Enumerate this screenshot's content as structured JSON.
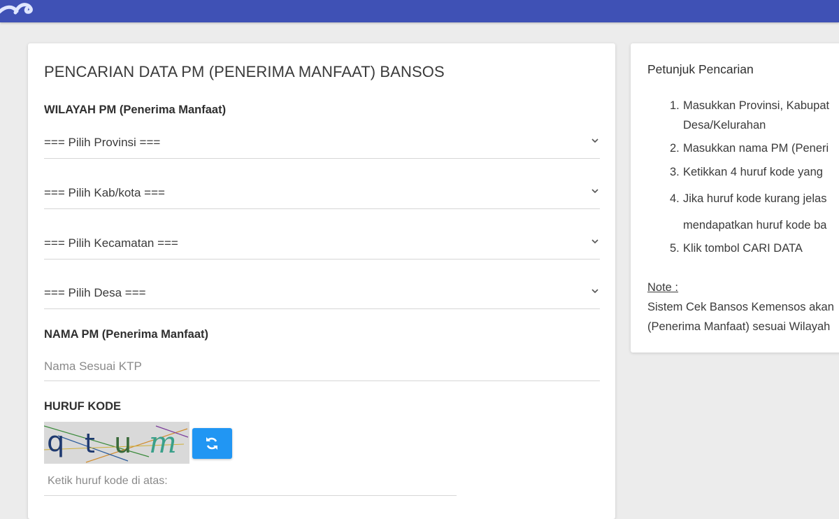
{
  "colors": {
    "topbar": "#3f51b5",
    "refresh_button": "#2196f3",
    "background": "#ececec"
  },
  "header": {
    "logo_icon": "logo-icon"
  },
  "search_form": {
    "title": "PENCARIAN DATA PM (PENERIMA MANFAAT) BANSOS",
    "region_label": "WILAYAH PM (Penerima Manfaat)",
    "selects": [
      {
        "label": "=== Pilih Provinsi ===",
        "icon": "chevron-down-icon"
      },
      {
        "label": "=== Pilih Kab/kota ===",
        "icon": "chevron-down-icon"
      },
      {
        "label": "=== Pilih Kecamatan ===",
        "icon": "chevron-down-icon"
      },
      {
        "label": "=== Pilih Desa ===",
        "icon": "chevron-down-icon"
      }
    ],
    "name_label": "NAMA PM (Penerima Manfaat)",
    "name_placeholder": "Nama Sesuai KTP",
    "name_value": "",
    "code_label": "HURUF KODE",
    "captcha_text": "qtum",
    "refresh_icon": "refresh-icon",
    "code_placeholder": "Ketik huruf kode di atas:",
    "code_value": ""
  },
  "instructions": {
    "title": "Petunjuk Pencarian",
    "steps": [
      {
        "number": "1.",
        "lines": [
          "Masukkan Provinsi, Kabupat",
          "Desa/Kelurahan"
        ]
      },
      {
        "number": "2.",
        "lines": [
          "Masukkan nama PM (Peneri"
        ]
      },
      {
        "number": "3.",
        "lines": [
          "Ketikkan 4 huruf kode yang"
        ]
      },
      {
        "number": "4.",
        "lines": [
          "Jika huruf kode kurang jelas",
          "mendapatkan huruf kode ba"
        ]
      },
      {
        "number": "5.",
        "lines": [
          "Klik tombol CARI DATA"
        ]
      }
    ],
    "note_label": "Note :",
    "note_lines": [
      "Sistem Cek Bansos Kemensos akan",
      "(Penerima Manfaat) sesuai Wilayah"
    ]
  }
}
